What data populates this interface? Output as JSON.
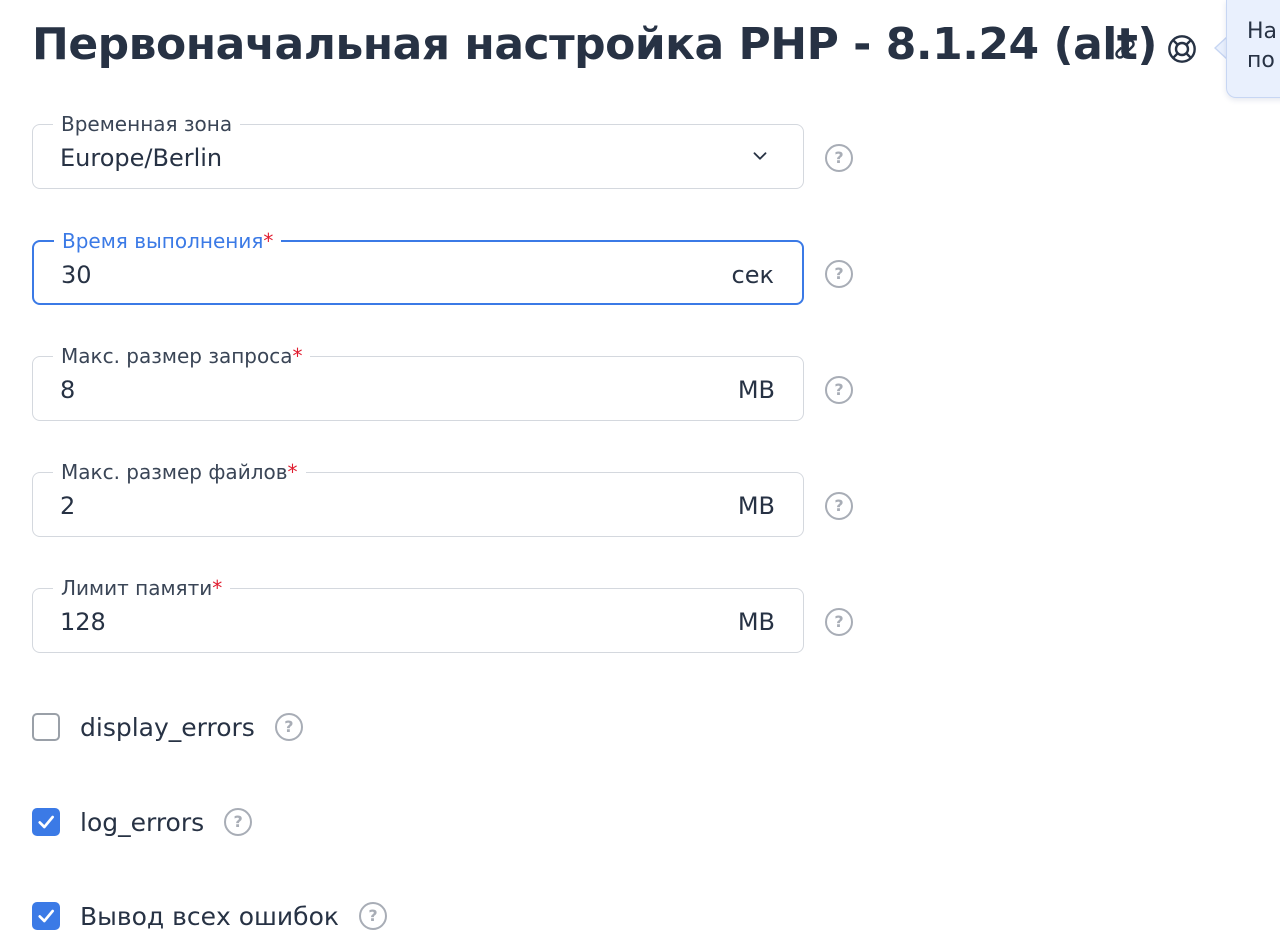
{
  "header": {
    "title": "Первоначальная настройка PHP - 8.1.24 (alt)",
    "link_icon": "link-icon",
    "help_icon": "lifebuoy-icon",
    "tooltip_lines": [
      "На",
      "по"
    ]
  },
  "fields": [
    {
      "label": "Временная зона",
      "required": false,
      "value": "Europe/Berlin",
      "unit": "",
      "type": "select",
      "focused": false
    },
    {
      "label": "Время выполнения",
      "required": true,
      "value": "30",
      "unit": "сек",
      "type": "input",
      "focused": true
    },
    {
      "label": "Макс. размер запроса",
      "required": true,
      "value": "8",
      "unit": "MB",
      "type": "input",
      "focused": false
    },
    {
      "label": "Макс. размер файлов",
      "required": true,
      "value": "2",
      "unit": "MB",
      "type": "input",
      "focused": false
    },
    {
      "label": "Лимит памяти",
      "required": true,
      "value": "128",
      "unit": "MB",
      "type": "input",
      "focused": false
    }
  ],
  "required_mark": "*",
  "help_mark": "?",
  "checkboxes": [
    {
      "label": "display_errors",
      "checked": false
    },
    {
      "label": "log_errors",
      "checked": true
    },
    {
      "label": "Вывод всех ошибок",
      "checked": true
    }
  ],
  "colors": {
    "accent": "#3b7ae6",
    "required": "#e01c2f",
    "text": "#273244",
    "tooltip_bg": "#e9f0fd"
  }
}
